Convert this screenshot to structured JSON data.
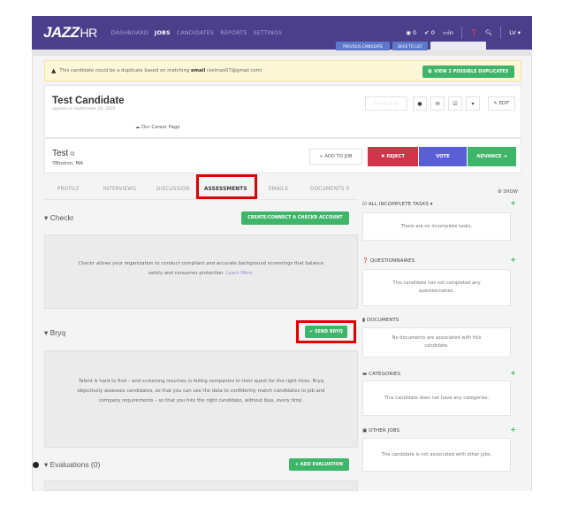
{
  "nav": {
    "logo": "JAZZ",
    "logo_suffix": "HR",
    "links": [
      "DASHBOARD",
      "JOBS",
      "CANDIDATES",
      "REPORTS",
      "SETTINGS"
    ],
    "active_link": "JOBS",
    "right": {
      "views_count": "0",
      "checks_count": "0",
      "inbox_label": "in",
      "user": "LV"
    }
  },
  "subbar_buttons": [
    "PREVIOUS CANDIDATE",
    "BACK TO LIST"
  ],
  "duplicate_banner": {
    "text_prefix": "This candidate could be a duplicate based on matching",
    "match_field": "email",
    "email": "(velmas07@gmail.com)",
    "button": "VIEW 2 POSSIBLE DUPLICATES"
  },
  "candidate": {
    "name": "Test Candidate",
    "applied": "applied on September 28, 2020",
    "source": "Our Career Page",
    "stars": "☆☆☆☆☆",
    "edit_label": "EDIT"
  },
  "job": {
    "title": "Test",
    "location": "Boston, MA",
    "add_to_job": "+ ADD TO JOB",
    "reject": "✖ REJECT",
    "vote": "VOTE",
    "advance": "ADVANCE ➔"
  },
  "tabs": [
    "PROFILE",
    "INTERVIEWS",
    "DISCUSSION",
    "ASSESSMENTS",
    "EMAILS",
    "DOCUMENTS  0"
  ],
  "active_tab": "ASSESSMENTS",
  "checkr": {
    "title": "▾ Checkr",
    "button": "CREATE/CONNECT A CHECKR ACCOUNT",
    "description": "Checkr allows your organization to conduct compliant and accurate background screenings that balance safety and consumer protection.",
    "learn_more": "Learn More."
  },
  "bryq": {
    "title": "▾ Bryq",
    "button": "✔ SEND BRYQ",
    "description": "Talent is hard to find – and screening resumes is failing companies in their quest for the right hires. Bryq objectively assesses candidates, so that you can use the data to confidently match candidates to job and company requirements – so that you hire the right candidate, without bias, every time."
  },
  "evaluations": {
    "title": "▾ Evaluations (0)",
    "button": "+ ADD EVALUATION"
  },
  "sidebar": {
    "show": "⚙ SHOW",
    "sections": [
      {
        "heading": "ALL INCOMPLETE TASKS ▾",
        "message": "There are no incomplete tasks.",
        "has_plus": true
      },
      {
        "heading": "QUESTIONNAIRES",
        "message": "This candidate has not completed any questionnaires.",
        "has_plus": true
      },
      {
        "heading": "DOCUMENTS",
        "message": "No documents are associated with this candidate.",
        "has_plus": false
      },
      {
        "heading": "CATEGORIES",
        "message": "This candidate does not have any categories.",
        "has_plus": true
      },
      {
        "heading": "OTHER JOBS",
        "message": "The candidate is not associated with other jobs.",
        "has_plus": true
      }
    ]
  },
  "colors": {
    "nav_bg": "#4b3f8c",
    "green": "#3fb56a",
    "reject": "#d0334a",
    "vote": "#5b5fd6",
    "highlight": "#e00000"
  }
}
